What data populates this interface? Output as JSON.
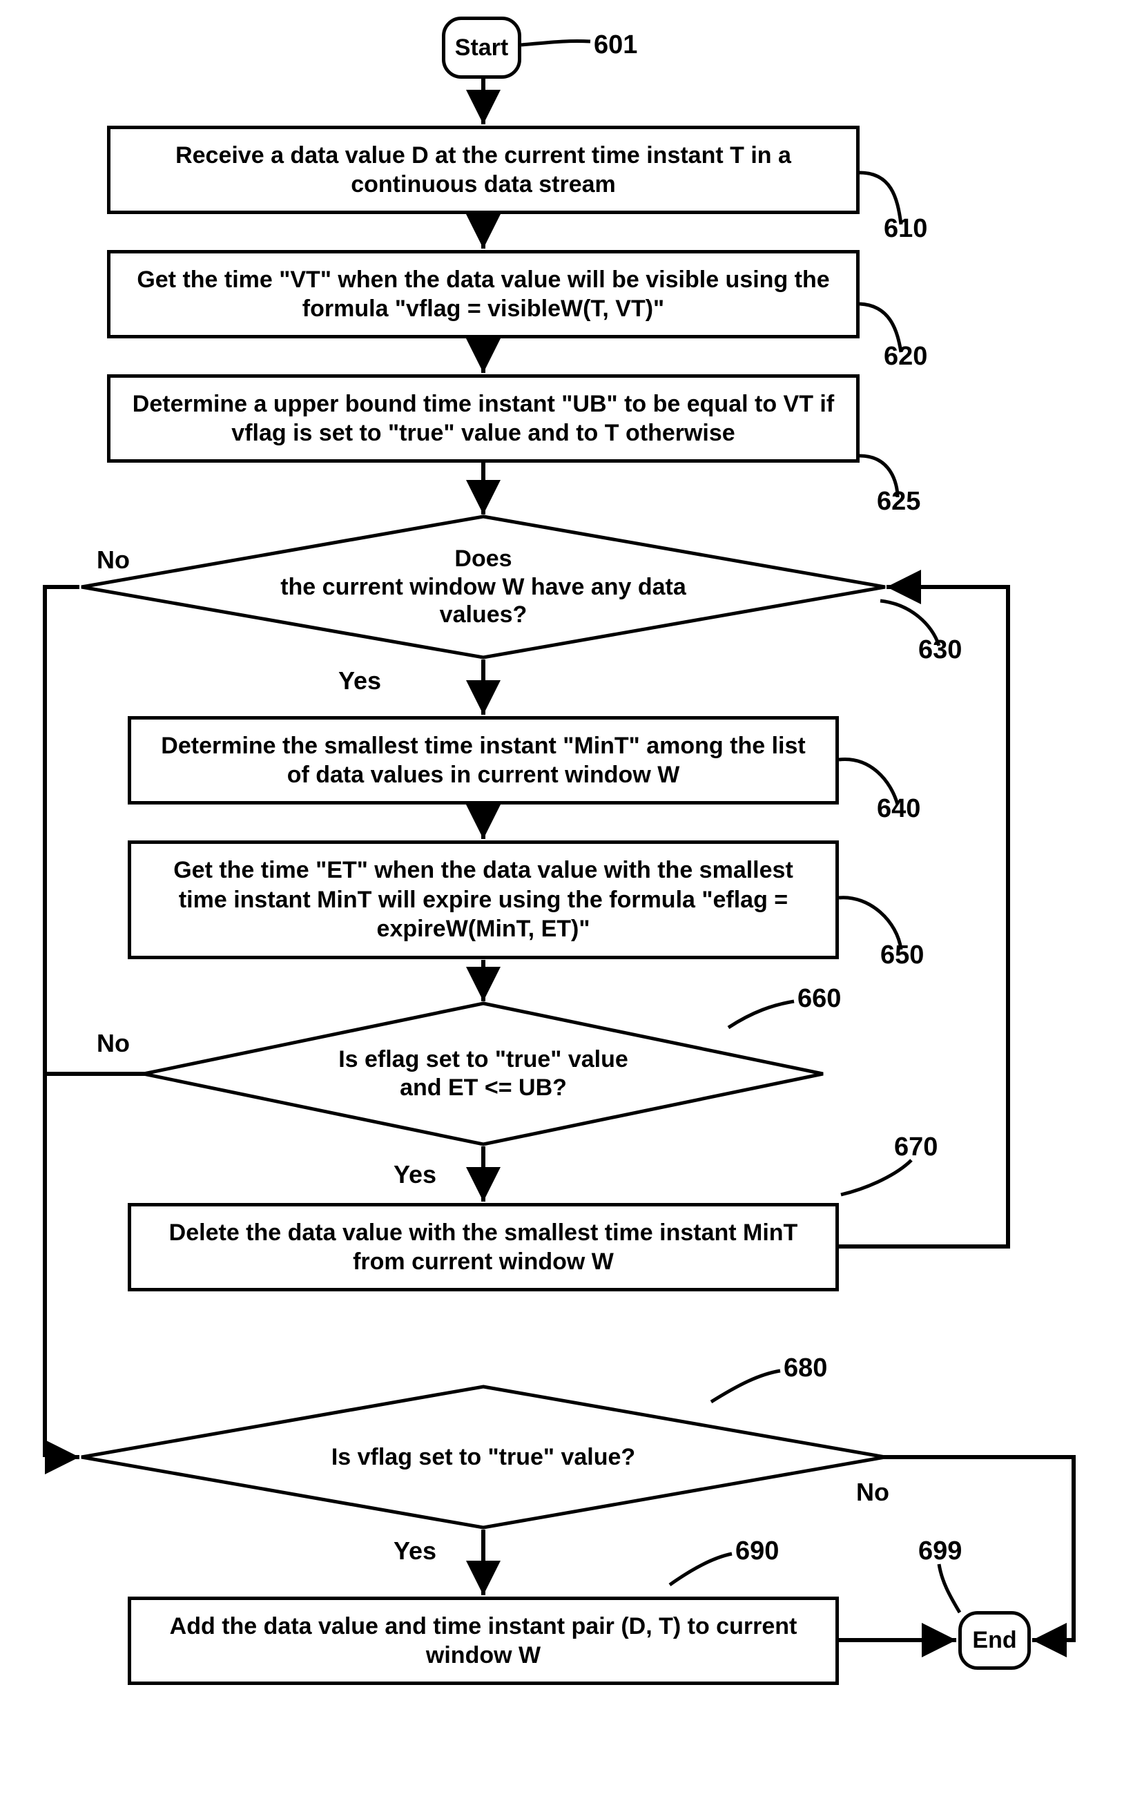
{
  "chart_data": {
    "type": "flowchart",
    "nodes": {
      "start": {
        "id": "601",
        "label": "Start",
        "shape": "terminator"
      },
      "s610": {
        "id": "610",
        "label": "Receive a data value D at the current time instant T in a continuous data stream",
        "shape": "process"
      },
      "s620": {
        "id": "620",
        "label": "Get the time \"VT\" when the data value will be visible using the formula \"vflag  = visibleW(T, VT)\"",
        "shape": "process"
      },
      "s625": {
        "id": "625",
        "label": "Determine a upper bound time instant \"UB\" to be equal to VT if vflag is set to \"true\" value and to T otherwise",
        "shape": "process"
      },
      "d630": {
        "id": "630",
        "label": "Does\nthe current window W have any data\nvalues?",
        "shape": "decision",
        "outcomes": {
          "Yes": "s640",
          "No": "d680"
        }
      },
      "s640": {
        "id": "640",
        "label": "Determine the smallest time instant \"MinT\" among the list of data values in current window W",
        "shape": "process"
      },
      "s650": {
        "id": "650",
        "label": "Get the time \"ET\" when the data value with the smallest time instant MinT will expire using the formula \"eflag = expireW(MinT, ET)\"",
        "shape": "process"
      },
      "d660": {
        "id": "660",
        "label": "Is eflag set to \"true\" value\nand ET <= UB?",
        "shape": "decision",
        "outcomes": {
          "Yes": "s670",
          "No": "d680"
        }
      },
      "s670": {
        "id": "670",
        "label": "Delete the data value with the smallest time instant MinT from current window W",
        "shape": "process",
        "next": "d630"
      },
      "d680": {
        "id": "680",
        "label": "Is vflag set to \"true\" value?",
        "shape": "decision",
        "outcomes": {
          "Yes": "s690",
          "No": "end"
        }
      },
      "s690": {
        "id": "690",
        "label": "Add the data value and time instant pair (D, T) to current window W",
        "shape": "process",
        "next": "end"
      },
      "end": {
        "id": "699",
        "label": "End",
        "shape": "terminator"
      }
    },
    "edges": [
      [
        "start",
        "s610"
      ],
      [
        "s610",
        "s620"
      ],
      [
        "s620",
        "s625"
      ],
      [
        "s625",
        "d630"
      ],
      [
        "d630",
        "s640",
        "Yes"
      ],
      [
        "d630",
        "d680",
        "No"
      ],
      [
        "s640",
        "s650"
      ],
      [
        "s650",
        "d660"
      ],
      [
        "d660",
        "s670",
        "Yes"
      ],
      [
        "d660",
        "d680",
        "No"
      ],
      [
        "s670",
        "d630"
      ],
      [
        "d680",
        "s690",
        "Yes"
      ],
      [
        "d680",
        "end",
        "No"
      ],
      [
        "s690",
        "end"
      ]
    ]
  },
  "labels": {
    "yes": "Yes",
    "no": "No"
  },
  "ref": {
    "n601": "601",
    "n610": "610",
    "n620": "620",
    "n625": "625",
    "n630": "630",
    "n640": "640",
    "n650": "650",
    "n660": "660",
    "n670": "670",
    "n680": "680",
    "n690": "690",
    "n699": "699"
  }
}
